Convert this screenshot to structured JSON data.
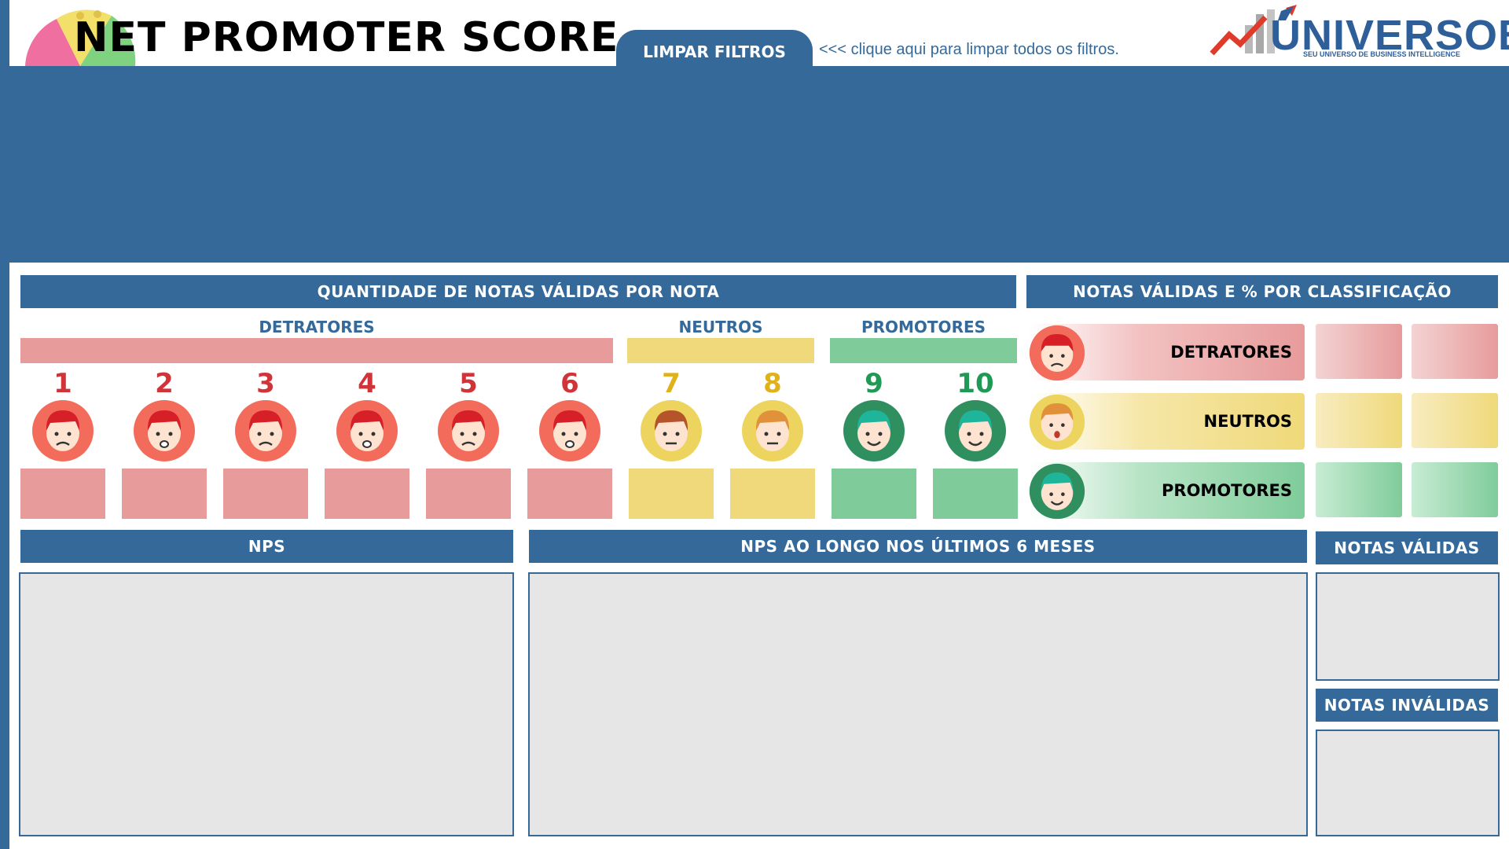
{
  "header": {
    "title": "NET PROMOTER SCORE",
    "clear_button": "LIMPAR FILTROS",
    "clear_hint": "<<< clique aqui para limpar todos os filtros.",
    "logo_text": "UNIVERSOBI",
    "logo_tagline": "SEU UNIVERSO DE BUSINESS INTELLIGENCE"
  },
  "colors": {
    "brand_blue": "#34699a",
    "detrator": "#e79b9b",
    "neutro": "#efd97a",
    "promotor": "#7fcc9a"
  },
  "notes_section": {
    "title": "QUANTIDADE DE NOTAS VÁLIDAS POR NOTA",
    "groups": {
      "detratores": "DETRATORES",
      "neutros": "NEUTROS",
      "promotores": "PROMOTORES"
    },
    "scores": [
      "1",
      "2",
      "3",
      "4",
      "5",
      "6",
      "7",
      "8",
      "9",
      "10"
    ]
  },
  "classification": {
    "title": "NOTAS VÁLIDAS E % POR CLASSIFICAÇÃO",
    "rows": [
      "DETRATORES",
      "NEUTROS",
      "PROMOTORES"
    ]
  },
  "panels": {
    "nps": "NPS",
    "nps_over_time": "NPS AO LONGO NOS ÚLTIMOS 6 MESES",
    "valid_notes": "NOTAS VÁLIDAS",
    "invalid_notes": "NOTAS INVÁLIDAS"
  }
}
